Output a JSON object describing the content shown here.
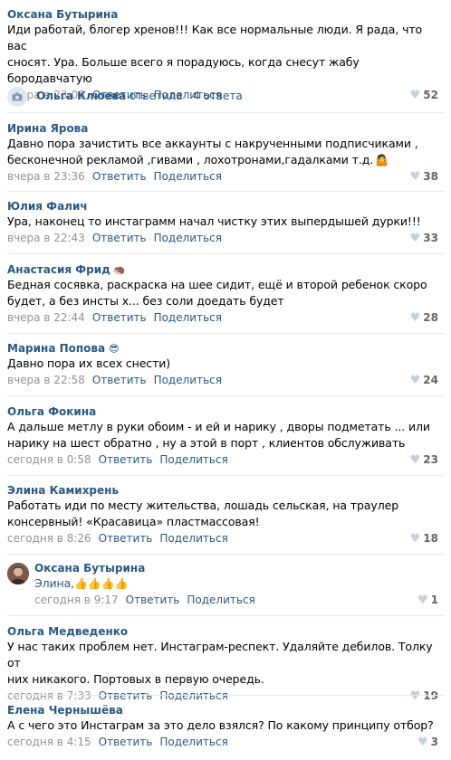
{
  "comments": [
    {
      "author": "Оксана Бутырина",
      "lines": [
        "Иди работай, блогер хренов!!! Как все нормальные люди. Я рада, что вас",
        "сносят. Ура. Больше всего я порадуюсь, когда снесут жабу бородавчатую"
      ],
      "time": "вчера в 23:06",
      "reply": "Ответить",
      "share": "Поделиться",
      "likes": "52"
    },
    {
      "author": "Ирина Ярова",
      "lines": [
        "Давно пора зачистить все аккаунты с накрученными подписчиками ,",
        "бесконечной рекламой ,гивами , лохотронами,гадалками т.д."
      ],
      "time": "вчера в 23:36",
      "reply": "Ответить",
      "share": "Поделиться",
      "likes": "38",
      "emoji": "🤷"
    },
    {
      "author": "Юлия Фалич",
      "lines": [
        "Ура, наконец то инстаграмм начал чистку этих выпердышей дурки!!!"
      ],
      "time": "вчера в 22:43",
      "reply": "Ответить",
      "share": "Поделиться",
      "likes": "33"
    },
    {
      "author": "Анастасия Фрид",
      "author_emoji": "🦔",
      "lines": [
        "Бедная сосявка, раскраска на шее сидит, ещё и второй ребенок скоро",
        "будет, а без инсты х... без соли доедать будет"
      ],
      "time": "вчера в 22:44",
      "reply": "Ответить",
      "share": "Поделиться",
      "likes": "28"
    },
    {
      "author": "Марина Попова",
      "author_emoji": "😎",
      "lines": [
        "Давно пора их всех снести)"
      ],
      "time": "вчера в 22:58",
      "reply": "Ответить",
      "share": "Поделиться",
      "likes": "24"
    },
    {
      "author": "Ольга Фокина",
      "lines": [
        "А дальше метлу в руки обоим - и ей и нарику , дворы подметать ... или",
        "нарику на шест обратно , ну а этой в порт , клиентов обслуживать"
      ],
      "time": "сегодня в 0:58",
      "reply": "Ответить",
      "share": "Поделиться",
      "likes": "23"
    },
    {
      "author": "Элина Камихрень",
      "lines": [
        "Работать иди по месту жительства, лошадь сельская, на траулер",
        "консервный! «Красавица» пластмассовая!"
      ],
      "time": "сегодня в 8:26",
      "reply": "Ответить",
      "share": "Поделиться",
      "likes": "18"
    },
    {
      "author": "Ольга Медведенко",
      "lines": [
        "У нас таких проблем нет. Инстаграм-респект. Удаляйте дебилов. Толку от",
        "них никакого. Портовых в первую очередь."
      ],
      "time": "сегодня в 7:33",
      "reply": "Ответить",
      "share": "Поделиться",
      "likes": "19"
    },
    {
      "author": "Елена Чернышёва",
      "lines": [
        "А с чего это Инстаграм за это дело взялся? По какому принципу отбор?"
      ],
      "time": "сегодня в 4:15",
      "reply": "Ответить",
      "share": "Поделиться",
      "likes": "3"
    }
  ],
  "thread": {
    "author": "Ольга Клюева",
    "action": "ответила",
    "separator": "·",
    "count": "4 ответа",
    "icon": "camera-icon"
  },
  "reply": {
    "author": "Оксана Бутырина",
    "text": "Элина,",
    "emoji": "👍👍👍👍",
    "time": "сегодня в 9:17",
    "reply": "Ответить",
    "share": "Поделиться",
    "likes": "1"
  },
  "colors": {
    "link": "#2a5885",
    "meta": "#939393",
    "divider": "#e7e8ec",
    "heart": "#c5d0db"
  }
}
